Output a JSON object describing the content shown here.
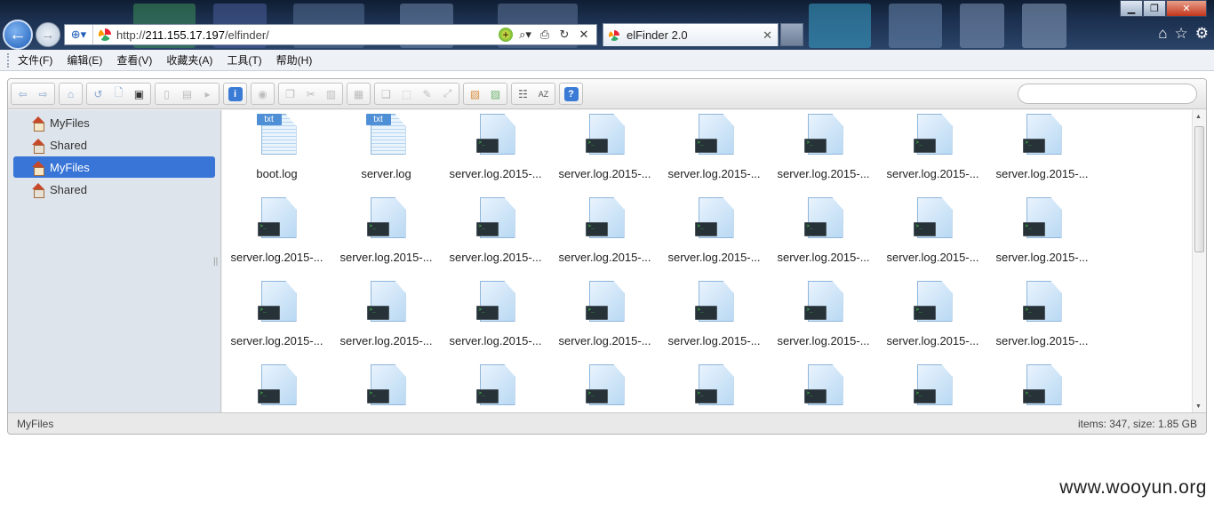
{
  "browser": {
    "url_prefix": "http://",
    "url_host": "211.155.17.197",
    "url_path": "/elfinder/",
    "tab_title": "elFinder 2.0",
    "compat_icon": "compat-view-icon",
    "window_controls": [
      "minimize",
      "maximize",
      "close"
    ],
    "right_icons": [
      "home-icon",
      "favorites-star-icon",
      "settings-gear-icon"
    ]
  },
  "menu": [
    "文件(F)",
    "编辑(E)",
    "查看(V)",
    "收藏夹(A)",
    "工具(T)",
    "帮助(H)"
  ],
  "toolbar": {
    "groups": [
      [
        "back-icon",
        "forward-icon"
      ],
      [
        "home-icon"
      ],
      [
        "reload-icon",
        "new-folder-icon",
        "save-icon"
      ],
      [
        "open-icon",
        "upload-icon",
        "select-icon"
      ],
      [
        "info-icon"
      ],
      [
        "preview-icon"
      ],
      [
        "copy-icon",
        "cut-icon",
        "paste-icon"
      ],
      [
        "delete-icon"
      ],
      [
        "duplicate-icon",
        "rename-icon",
        "edit-icon",
        "resize-icon"
      ],
      [
        "archive-icon",
        "extract-icon"
      ],
      [
        "view-icon",
        "sort-icon"
      ],
      [
        "help-icon"
      ]
    ]
  },
  "tree": [
    {
      "label": "MyFiles",
      "selected": false,
      "icon": "home-icon"
    },
    {
      "label": "Shared",
      "selected": false,
      "icon": "home-icon"
    },
    {
      "label": "MyFiles",
      "selected": true,
      "icon": "home-icon"
    },
    {
      "label": "Shared",
      "selected": false,
      "icon": "home-icon"
    }
  ],
  "files": [
    {
      "name": "boot.log",
      "type": "txt"
    },
    {
      "name": "server.log",
      "type": "txt"
    },
    {
      "name": "server.log.2015-...",
      "type": "term"
    },
    {
      "name": "server.log.2015-...",
      "type": "term"
    },
    {
      "name": "server.log.2015-...",
      "type": "term"
    },
    {
      "name": "server.log.2015-...",
      "type": "term"
    },
    {
      "name": "server.log.2015-...",
      "type": "term"
    },
    {
      "name": "server.log.2015-...",
      "type": "term"
    },
    {
      "name": "server.log.2015-...",
      "type": "term"
    },
    {
      "name": "server.log.2015-...",
      "type": "term"
    },
    {
      "name": "server.log.2015-...",
      "type": "term"
    },
    {
      "name": "server.log.2015-...",
      "type": "term"
    },
    {
      "name": "server.log.2015-...",
      "type": "term"
    },
    {
      "name": "server.log.2015-...",
      "type": "term"
    },
    {
      "name": "server.log.2015-...",
      "type": "term"
    },
    {
      "name": "server.log.2015-...",
      "type": "term"
    },
    {
      "name": "server.log.2015-...",
      "type": "term"
    },
    {
      "name": "server.log.2015-...",
      "type": "term"
    },
    {
      "name": "server.log.2015-...",
      "type": "term"
    },
    {
      "name": "server.log.2015-...",
      "type": "term"
    },
    {
      "name": "server.log.2015-...",
      "type": "term"
    },
    {
      "name": "server.log.2015-...",
      "type": "term"
    },
    {
      "name": "server.log.2015-...",
      "type": "term"
    },
    {
      "name": "server.log.2015-...",
      "type": "term"
    },
    {
      "name": "",
      "type": "term"
    },
    {
      "name": "",
      "type": "term"
    },
    {
      "name": "",
      "type": "term"
    },
    {
      "name": "",
      "type": "term"
    },
    {
      "name": "",
      "type": "term"
    },
    {
      "name": "",
      "type": "term"
    },
    {
      "name": "",
      "type": "term"
    },
    {
      "name": "",
      "type": "term"
    }
  ],
  "status": {
    "path": "MyFiles",
    "summary": "items: 347, size: 1.85 GB"
  },
  "watermark": "www.wooyun.org",
  "colors": {
    "selection": "#3875d7",
    "tree_bg": "#dde4eb",
    "txt_tag": "#4f8fd6"
  }
}
